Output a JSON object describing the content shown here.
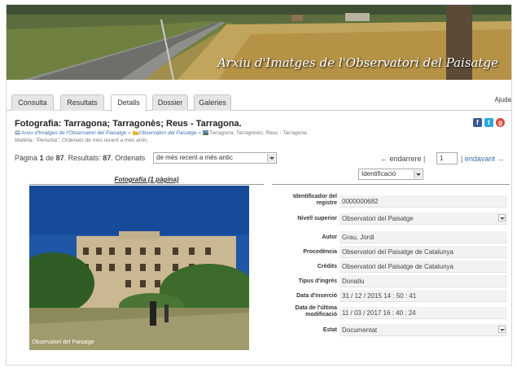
{
  "banner": {
    "title": "Arxiu d'Imatges de l'Observatori del Paisatge"
  },
  "tabs": [
    {
      "label": "Consulta",
      "active": false
    },
    {
      "label": "Resultats",
      "active": false
    },
    {
      "label": "Detalls",
      "active": true
    },
    {
      "label": "Dossier",
      "active": false
    },
    {
      "label": "Galeries",
      "active": false
    }
  ],
  "help": "Ajuda",
  "record": {
    "title": "Fotografia: Tarragona; Tarragonès; Reus - Tarragona.",
    "breadcrumb": {
      "root": "Arxiu d'Imatges de l'Observatori del Paisatge",
      "sep1": "»",
      "collection": "Observatori del Paisatge",
      "sep2": "»",
      "current": "Tarragona; Tarragonès; Reus - Tarragona."
    },
    "matter": "Matèria: \"Periurbà\". Ordenats de més recent a més antic."
  },
  "social": {
    "facebook": "f",
    "twitter": "t",
    "google": "g"
  },
  "pager": {
    "page_label": "Pàgina",
    "page": "1",
    "of_label": "de",
    "total_pages": "87",
    "results_label": "Resultats:",
    "results": "87",
    "sorted_label": "Ordenats",
    "sort_value": "de més recent a més antic",
    "prev": "← endarrere",
    "separator": "|",
    "page_input": "1",
    "next": "| endavant →"
  },
  "left_column": {
    "heading": "Fotografia (1 pàgina)"
  },
  "photo": {
    "caption": "Observatori del Paisatge"
  },
  "right_column": {
    "view_select": "Identificació"
  },
  "metadata": [
    {
      "label": "Identificador del registre",
      "value": "0000000682",
      "dropdown": false
    },
    {
      "label": "Nivell superior",
      "value": "Observatori del Paisatge",
      "dropdown": true
    },
    {
      "label": "Autor",
      "value": "Grau, Jordi",
      "dropdown": false
    },
    {
      "label": "Procedència",
      "value": "Observatori del Paisatge de Catalunya",
      "dropdown": false
    },
    {
      "label": "Crèdits",
      "value": "Observatori del Paisatge de Catalunya",
      "dropdown": false
    },
    {
      "label": "Tipus d'ingrés",
      "value": "Donatiu",
      "dropdown": false
    },
    {
      "label": "Data d'inserció",
      "value": "31 / 12 / 2015 14 : 50 : 41",
      "dropdown": false
    },
    {
      "label": "Data de l'última modificació",
      "value": "11 / 03 / 2017 16 : 40 : 24",
      "dropdown": false
    },
    {
      "label": "Estat",
      "value": "Documentat",
      "dropdown": true
    }
  ],
  "colors": {
    "link": "#3a6fb0",
    "facebook": "#3b5998",
    "twitter": "#2aa9e0",
    "google": "#dd4b39"
  }
}
